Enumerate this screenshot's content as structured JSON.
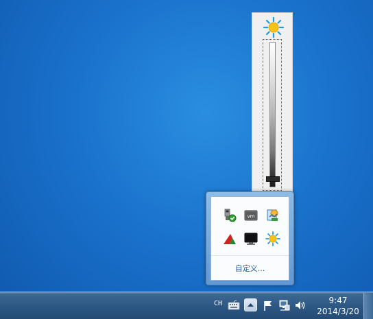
{
  "brightness_popup": {
    "icon": "sun-icon",
    "level": 0.04
  },
  "overflow_tray": {
    "icons": [
      "safely-remove-usb-icon",
      "vmware-icon",
      "network-tool-icon",
      "red-arrow-app-icon",
      "monitor-icon",
      "brightness-sun-icon"
    ],
    "customize_label": "自定义..."
  },
  "taskbar": {
    "language": "CH",
    "keyboard_icon": "keyboard-icon",
    "show_hidden_icon": "chevron-up-icon",
    "flag_icon": "action-center-flag-icon",
    "network_icon": "network-icon",
    "volume_icon": "volume-icon",
    "time": "9:47",
    "date": "2014/3/20"
  },
  "colors": {
    "desktop": "#1a72cc",
    "taskbar": "#2b5682",
    "link": "#1a5aa8"
  }
}
